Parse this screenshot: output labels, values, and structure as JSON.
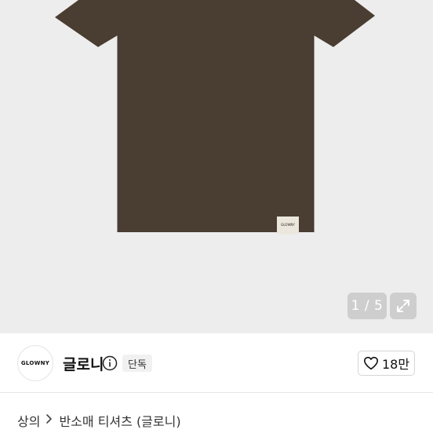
{
  "gallery": {
    "counter": "1 / 5",
    "shirt_label": "GLOWNY"
  },
  "brand": {
    "logo_text": "GLOWNY",
    "name": "글로니",
    "badge": "단독"
  },
  "like": {
    "count": "18만"
  },
  "breadcrumb": {
    "category": "상의",
    "subcategory": "반소매 티셔츠 (글로니)"
  },
  "colors": {
    "shirt": "#4a3d31",
    "background": "#ededed"
  },
  "icons": [
    "expand-icon",
    "info-icon",
    "heart-icon",
    "chevron-right-icon"
  ]
}
